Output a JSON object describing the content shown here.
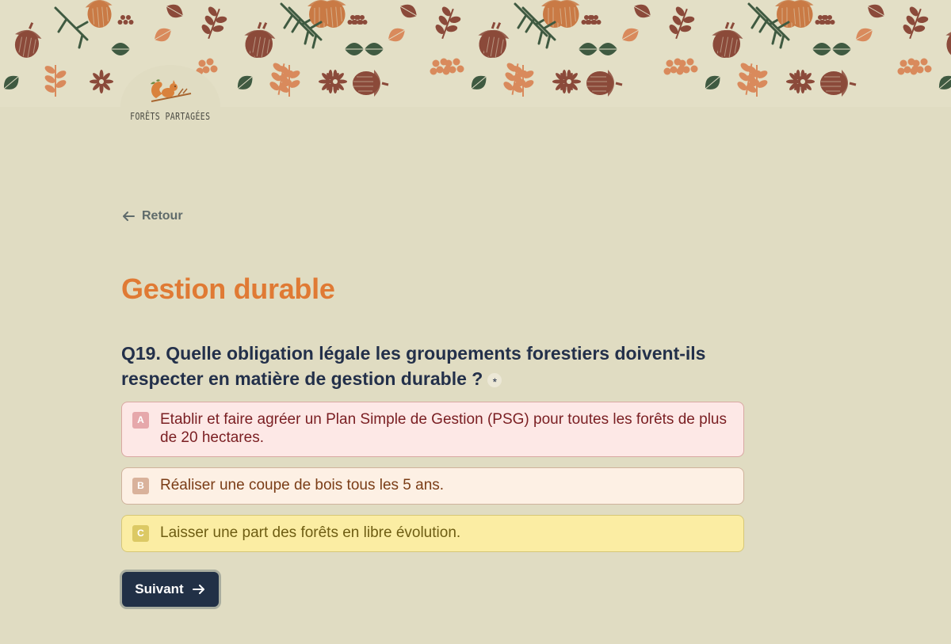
{
  "brand": {
    "name": "FORÊTS PARTAGÉES",
    "logo_icon": "squirrel-icon"
  },
  "nav": {
    "back_label": "Retour",
    "back_icon": "arrow-left-icon"
  },
  "section": {
    "title": "Gestion durable"
  },
  "question": {
    "text": "Q19. Quelle obligation légale les groupements forestiers doivent-ils respecter en matière de gestion durable ?",
    "required_marker": "*"
  },
  "options": [
    {
      "key": "A",
      "text": "Etablir et faire agréer un Plan Simple de Gestion (PSG) pour toutes les forêts de plus de 20 hectares."
    },
    {
      "key": "B",
      "text": "Réaliser une coupe de bois tous les 5 ans."
    },
    {
      "key": "C",
      "text": "Laisser une part des forêts en libre évolution."
    }
  ],
  "actions": {
    "next_label": "Suivant",
    "next_icon": "arrow-right-icon"
  },
  "colors": {
    "background": "#e0dcc2",
    "title": "#e07a34",
    "question": "#23304a",
    "button": "#213046"
  }
}
